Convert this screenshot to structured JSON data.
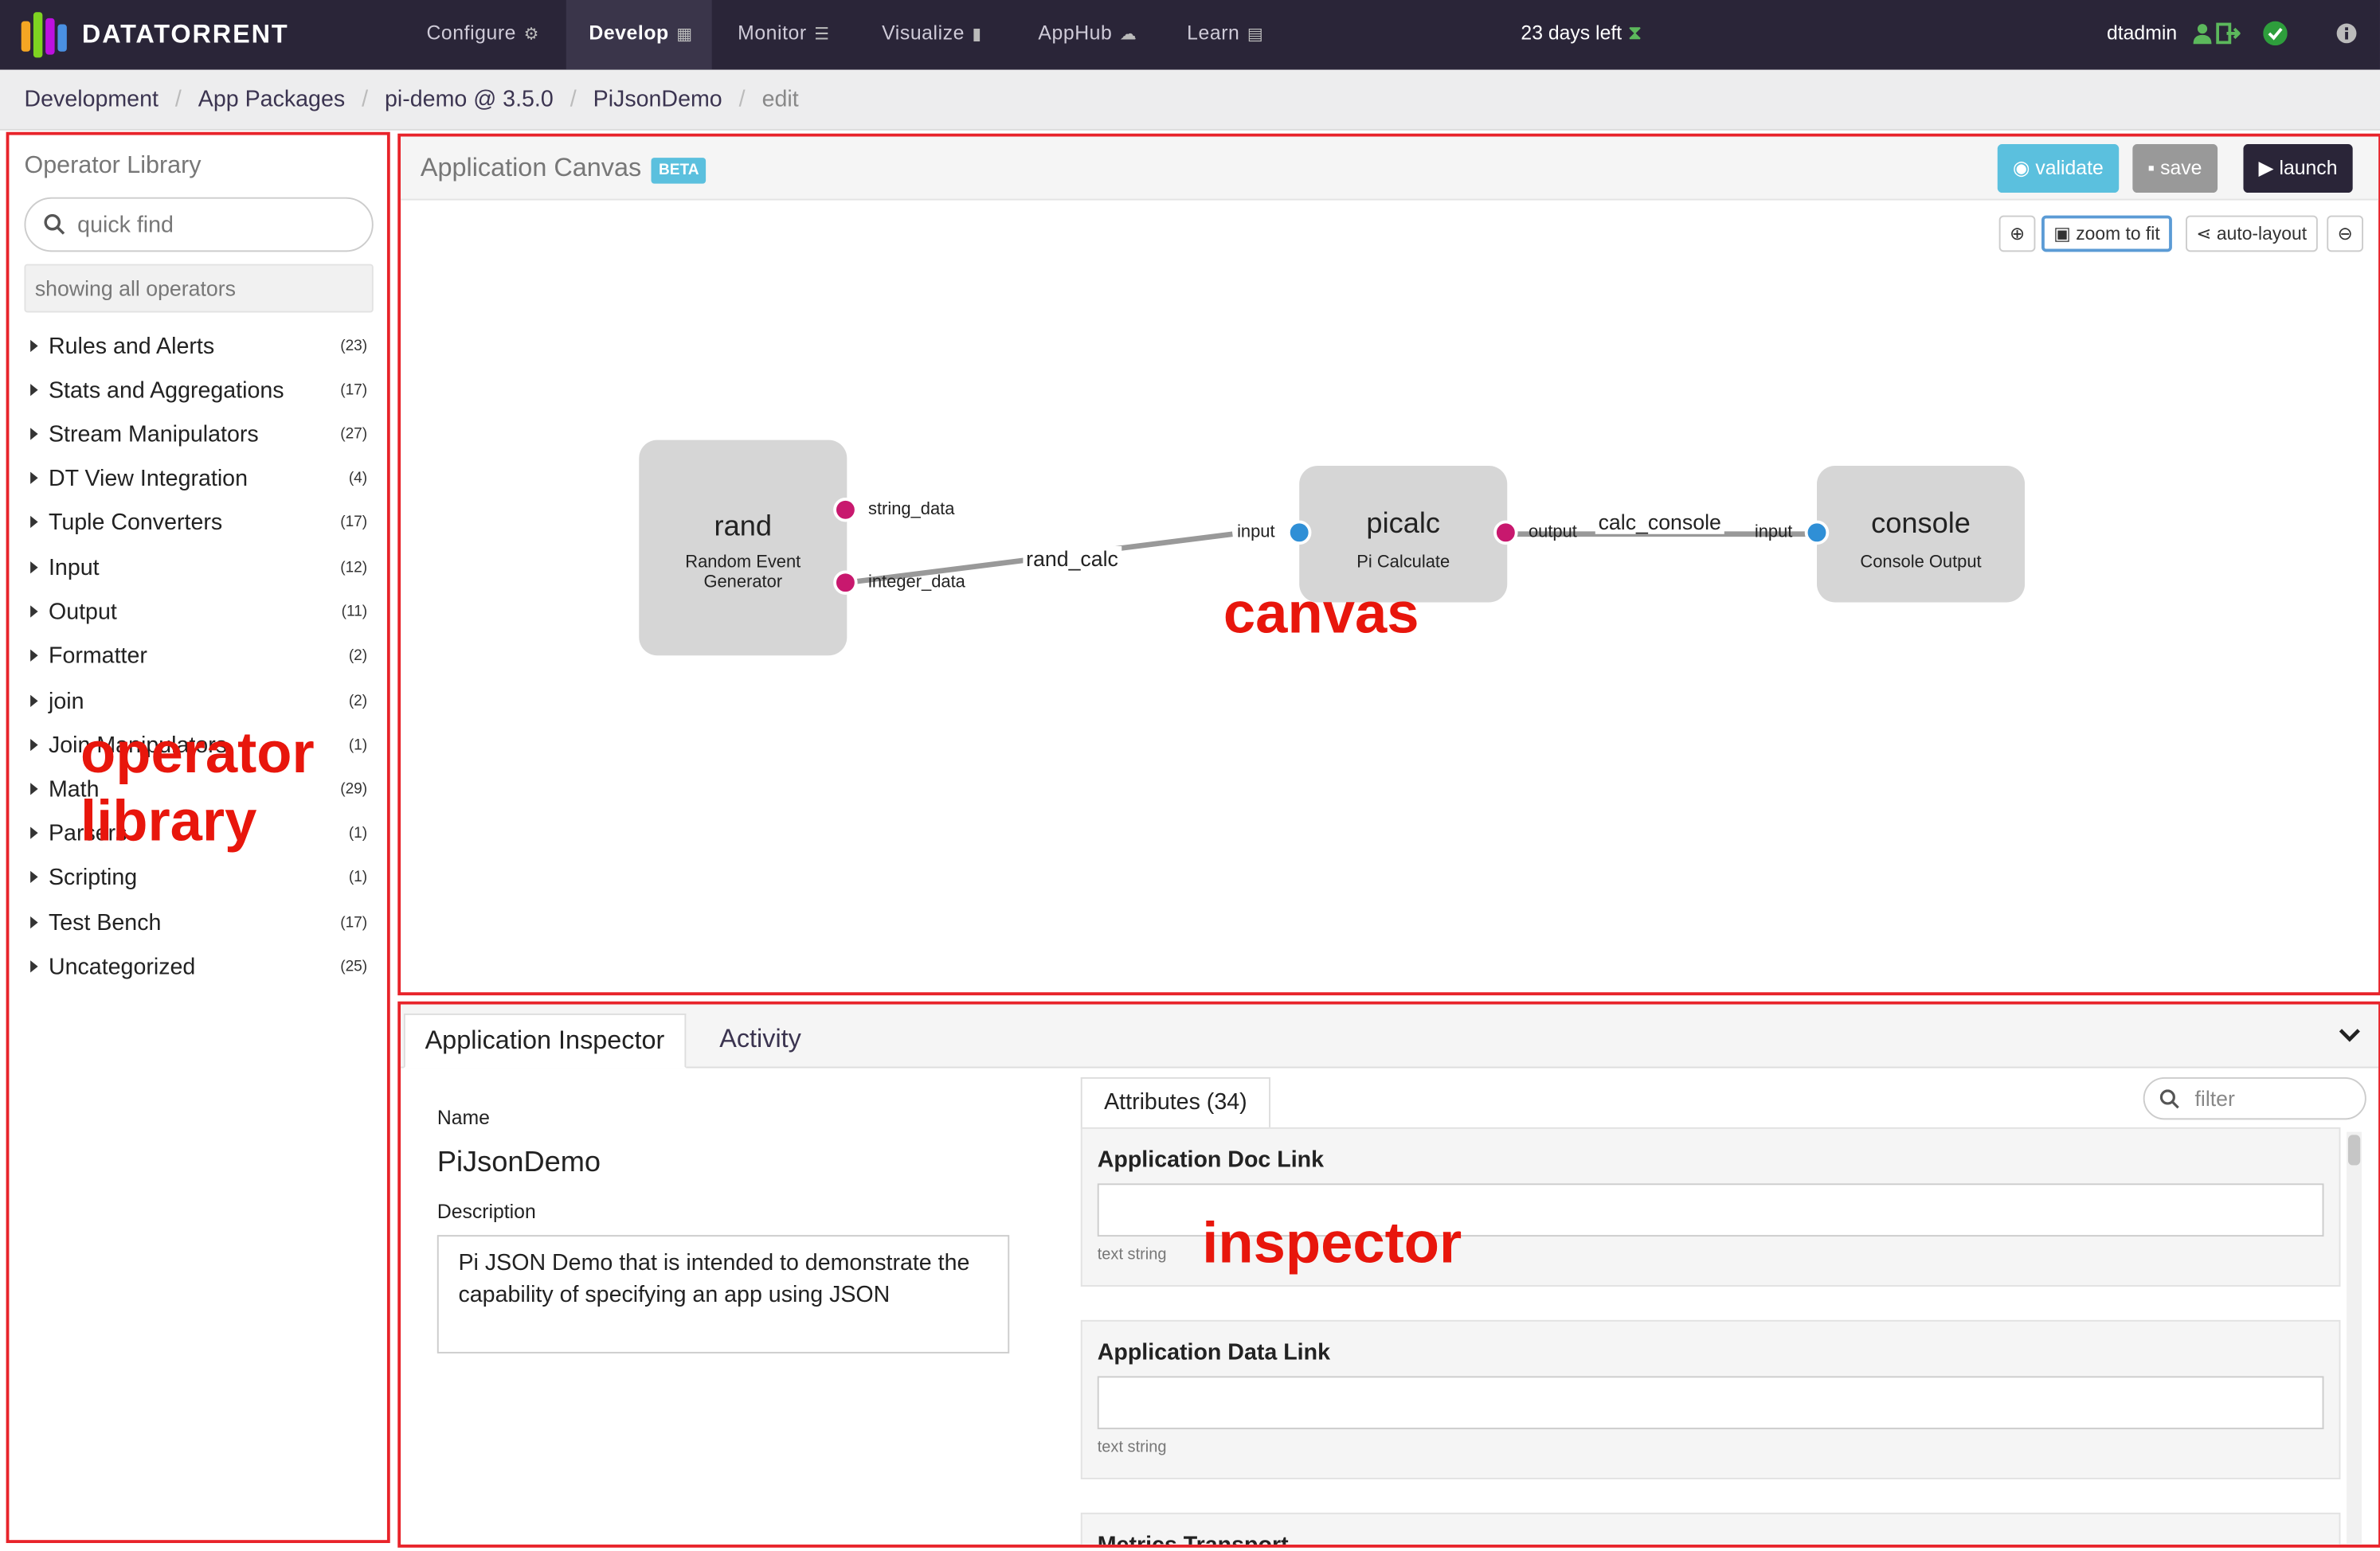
{
  "app": {
    "brand": "DATATORRENT",
    "trial_text": "23 days left",
    "username": "dtadmin",
    "colors": {
      "nav_bg": "#2a2538",
      "annotation_red": "#e8160c",
      "validate": "#5bc0de",
      "save": "#999999",
      "launch": "#2a2538",
      "output_port": "#c8186e",
      "input_port": "#2f8fd6"
    }
  },
  "nav": [
    {
      "label": "Configure",
      "icon": "gear-icon"
    },
    {
      "label": "Develop",
      "icon": "grid-icon",
      "active": true
    },
    {
      "label": "Monitor",
      "icon": "list-icon"
    },
    {
      "label": "Visualize",
      "icon": "bar-chart-icon"
    },
    {
      "label": "AppHub",
      "icon": "cloud-icon"
    },
    {
      "label": "Learn",
      "icon": "book-icon"
    }
  ],
  "breadcrumb": [
    "Development",
    "App Packages",
    "pi-demo @ 3.5.0",
    "PiJsonDemo",
    "edit"
  ],
  "library": {
    "title": "Operator Library",
    "search_placeholder": "quick find",
    "showing": "showing all operators",
    "categories": [
      {
        "name": "Rules and Alerts",
        "count": "(23)"
      },
      {
        "name": "Stats and Aggregations",
        "count": "(17)"
      },
      {
        "name": "Stream Manipulators",
        "count": "(27)"
      },
      {
        "name": "DT View Integration",
        "count": "(4)"
      },
      {
        "name": "Tuple Converters",
        "count": "(17)"
      },
      {
        "name": "Input",
        "count": "(12)"
      },
      {
        "name": "Output",
        "count": "(11)"
      },
      {
        "name": "Formatter",
        "count": "(2)"
      },
      {
        "name": "join",
        "count": "(2)"
      },
      {
        "name": "Join Manipulators",
        "count": "(1)"
      },
      {
        "name": "Math",
        "count": "(29)"
      },
      {
        "name": "Parsers",
        "count": "(1)"
      },
      {
        "name": "Scripting",
        "count": "(1)"
      },
      {
        "name": "Test Bench",
        "count": "(17)"
      },
      {
        "name": "Uncategorized",
        "count": "(25)"
      }
    ]
  },
  "canvas": {
    "title": "Application Canvas",
    "badge": "BETA",
    "buttons": {
      "validate": "validate",
      "save": "save",
      "launch": "launch"
    },
    "tools": {
      "zoom_to_fit": "zoom to fit",
      "auto_layout": "auto-layout"
    },
    "operators": [
      {
        "name": "rand",
        "desc": "Random Event Generator"
      },
      {
        "name": "picalc",
        "desc": "Pi Calculate"
      },
      {
        "name": "console",
        "desc": "Console Output"
      }
    ],
    "ports": {
      "string_data": "string_data",
      "integer_data": "integer_data",
      "input": "input",
      "output": "output"
    },
    "streams": [
      "rand_calc",
      "calc_console"
    ]
  },
  "inspector": {
    "tabs": [
      "Application Inspector",
      "Activity"
    ],
    "name_label": "Name",
    "name_value": "PiJsonDemo",
    "description_label": "Description",
    "description_value": "Pi JSON Demo that is intended to demonstrate the capability of specifying an app using JSON",
    "attributes_tab": "Attributes (34)",
    "filter_placeholder": "filter",
    "attributes": [
      {
        "title": "Application Doc Link",
        "hint": "text string"
      },
      {
        "title": "Application Data Link",
        "hint": "text string"
      },
      {
        "title": "Metrics Transport",
        "hint": ""
      }
    ]
  },
  "annotations": {
    "library_line1": "operator",
    "library_line2": "library",
    "canvas": "canvas",
    "inspector": "inspector"
  }
}
